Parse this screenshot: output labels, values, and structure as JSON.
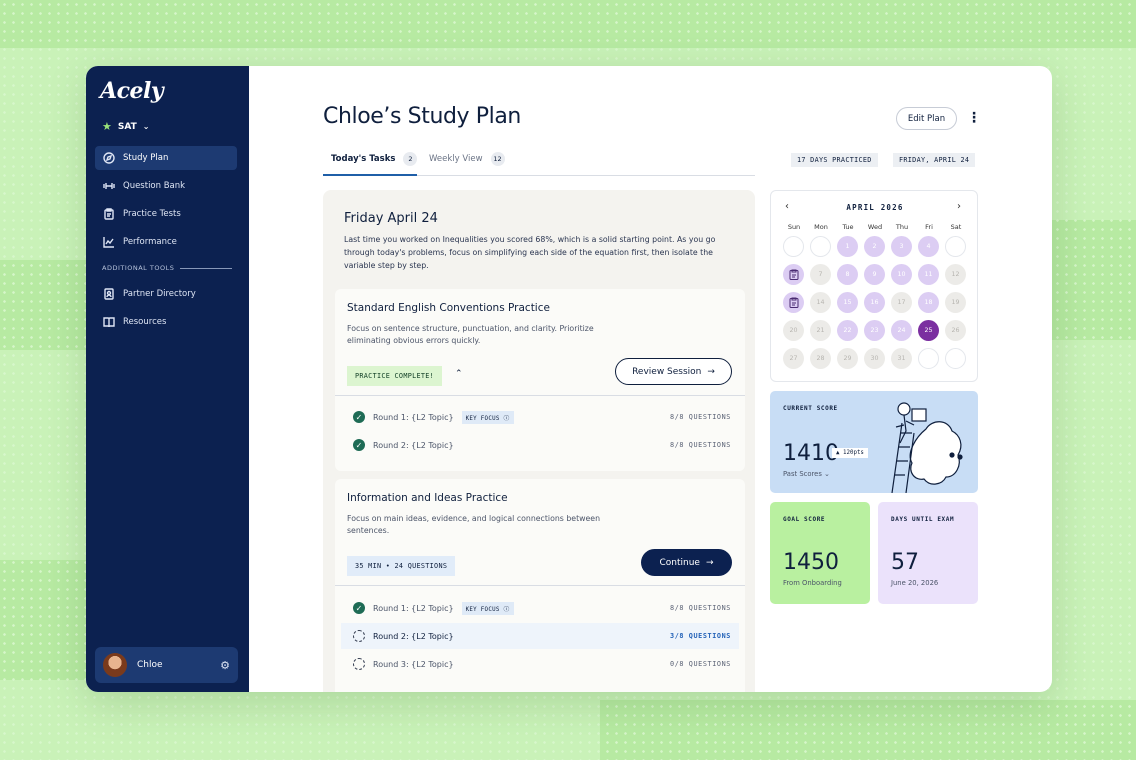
{
  "sidebar": {
    "logo": "Acely",
    "exam": "SAT",
    "nav": [
      {
        "label": "Study Plan"
      },
      {
        "label": "Question Bank"
      },
      {
        "label": "Practice Tests"
      },
      {
        "label": "Performance"
      }
    ],
    "tools_label": "ADDITIONAL TOOLS",
    "tools": [
      {
        "label": "Partner Directory"
      },
      {
        "label": "Resources"
      }
    ],
    "user_name": "Chloe"
  },
  "header": {
    "title": "Chloe’s Study Plan",
    "edit_label": "Edit Plan",
    "tabs": [
      {
        "label": "Today's Tasks",
        "count": "2"
      },
      {
        "label": "Weekly View",
        "count": "12"
      }
    ],
    "days_practiced": "17 DAYS PRACTICED",
    "today": "FRIDAY, APRIL 24"
  },
  "plan": {
    "date": "Friday April 24",
    "intro": "Last time you worked on Inequalities you scored 68%, which is a solid starting point. As you go through today's problems, focus on simplifying each side of the equation first, then isolate the variable step by step.",
    "cards": [
      {
        "title": "Standard English Conventions Practice",
        "desc": "Focus on sentence structure, punctuation, and clarity. Prioritize eliminating obvious errors quickly.",
        "badge": "PRACTICE COMPLETE!",
        "button": "Review Session",
        "rounds": [
          {
            "label": "Round 1: {L2 Topic}",
            "key_focus": "KEY FOCUS",
            "questions": "8/8 QUESTIONS",
            "status": "done"
          },
          {
            "label": "Round 2: {L2 Topic}",
            "questions": "8/8 QUESTIONS",
            "status": "done"
          }
        ]
      },
      {
        "title": "Information and Ideas Practice",
        "desc": "Focus on main ideas, evidence, and logical connections between sentences.",
        "badge": "35 MIN • 24 QUESTIONS",
        "button": "Continue",
        "rounds": [
          {
            "label": "Round 1: {L2 Topic}",
            "key_focus": "KEY FOCUS",
            "questions": "8/8 QUESTIONS",
            "status": "done"
          },
          {
            "label": "Round 2: {L2 Topic}",
            "questions": "3/8 QUESTIONS",
            "status": "in-progress"
          },
          {
            "label": "Round 3: {L2 Topic}",
            "questions": "0/8 QUESTIONS",
            "status": "todo"
          }
        ]
      }
    ]
  },
  "calendar": {
    "month": "APRIL 2026",
    "weekdays": [
      "Sun",
      "Mon",
      "Tue",
      "Wed",
      "Thu",
      "Fri",
      "Sat"
    ],
    "weeks": [
      [
        "",
        "",
        "1",
        "2",
        "3",
        "4",
        ""
      ],
      [
        "",
        "7",
        "8",
        "9",
        "10",
        "11",
        "12"
      ],
      [
        "",
        "14",
        "15",
        "16",
        "17",
        "18",
        "19"
      ],
      [
        "20",
        "21",
        "22",
        "23",
        "24",
        "25",
        "26"
      ],
      [
        "27",
        "28",
        "29",
        "30",
        "31",
        "",
        ""
      ]
    ],
    "practiced_days": [
      "1",
      "2",
      "3",
      "4",
      "8",
      "9",
      "10",
      "11",
      "15",
      "16",
      "18",
      "22",
      "23",
      "24"
    ],
    "test_days_icon": "clipboard-icon",
    "selected_day": "25",
    "colors": {
      "practiced": "#dccdf3",
      "selected": "#7b2fa0",
      "empty": "#ecebe8"
    }
  },
  "scores": {
    "current": {
      "label": "CURRENT SCORE",
      "value": "1410",
      "delta": "▲ 120pts",
      "past": "Past Scores"
    },
    "goal": {
      "label": "GOAL SCORE",
      "value": "1450",
      "sub": "From Onboarding"
    },
    "days": {
      "label": "DAYS UNTIL EXAM",
      "value": "57",
      "sub": "June 20, 2026"
    }
  },
  "colors": {
    "sidebar": "#0c2150",
    "accent_green": "#b9f0a0",
    "accent_blue": "#c8ddf5",
    "accent_lavender": "#ebe2fb"
  }
}
